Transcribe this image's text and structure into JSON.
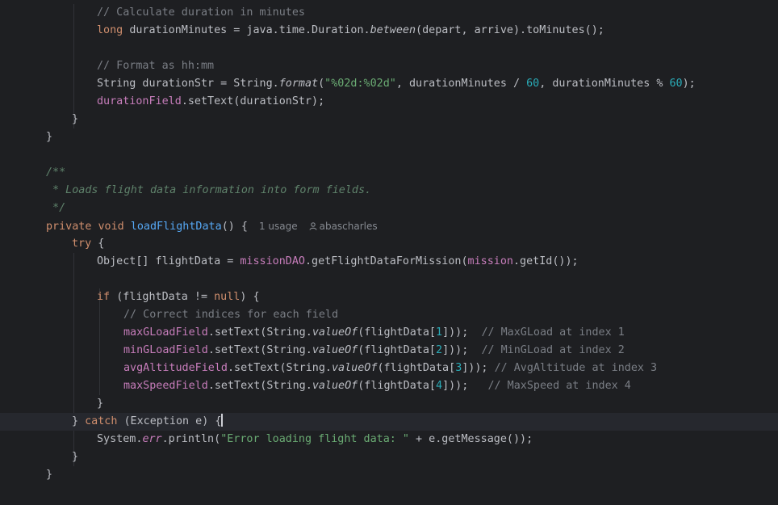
{
  "editor": {
    "current_line_index": 23,
    "caret_line_index": 23,
    "lines": [
      {
        "indent": 120,
        "tokens": [
          {
            "t": "// Calculate duration in minutes",
            "k": "comment"
          }
        ]
      },
      {
        "indent": 120,
        "tokens": [
          {
            "t": "long ",
            "k": "keyword"
          },
          {
            "t": "durationMinutes = java.time.Duration.",
            "k": "plain"
          },
          {
            "t": "between",
            "k": "static"
          },
          {
            "t": "(depart, arrive).toMinutes();",
            "k": "plain"
          }
        ]
      },
      {
        "indent": 0,
        "tokens": []
      },
      {
        "indent": 120,
        "tokens": [
          {
            "t": "// Format as hh:mm",
            "k": "comment"
          }
        ]
      },
      {
        "indent": 120,
        "tokens": [
          {
            "t": "String durationStr = String.",
            "k": "plain"
          },
          {
            "t": "format",
            "k": "static"
          },
          {
            "t": "(",
            "k": "plain"
          },
          {
            "t": "\"%02d:%02d\"",
            "k": "string"
          },
          {
            "t": ", durationMinutes / ",
            "k": "plain"
          },
          {
            "t": "60",
            "k": "number"
          },
          {
            "t": ", durationMinutes % ",
            "k": "plain"
          },
          {
            "t": "60",
            "k": "number"
          },
          {
            "t": ");",
            "k": "plain"
          }
        ]
      },
      {
        "indent": 120,
        "tokens": [
          {
            "t": "durationField",
            "k": "field"
          },
          {
            "t": ".setText(durationStr);",
            "k": "plain"
          }
        ]
      },
      {
        "indent": 89,
        "tokens": [
          {
            "t": "}",
            "k": "plain"
          }
        ]
      },
      {
        "indent": 57,
        "tokens": [
          {
            "t": "}",
            "k": "plain"
          }
        ]
      },
      {
        "indent": 0,
        "tokens": []
      },
      {
        "indent": 57,
        "tokens": [
          {
            "t": "/**",
            "k": "doc"
          }
        ]
      },
      {
        "indent": 57,
        "tokens": [
          {
            "t": " * Loads flight data information into form fields.",
            "k": "doc"
          }
        ]
      },
      {
        "indent": 57,
        "tokens": [
          {
            "t": " */",
            "k": "doc"
          }
        ]
      },
      {
        "indent": 57,
        "tokens": [
          {
            "t": "private void ",
            "k": "keyword"
          },
          {
            "t": "loadFlightData",
            "k": "method"
          },
          {
            "t": "() {",
            "k": "plain"
          }
        ],
        "inlay": {
          "usage": "1 usage",
          "author": "abascharles"
        }
      },
      {
        "indent": 89,
        "tokens": [
          {
            "t": "try ",
            "k": "keyword"
          },
          {
            "t": "{",
            "k": "plain"
          }
        ]
      },
      {
        "indent": 120,
        "tokens": [
          {
            "t": "Object[] flightData = ",
            "k": "plain"
          },
          {
            "t": "missionDAO",
            "k": "field"
          },
          {
            "t": ".getFlightDataForMission(",
            "k": "plain"
          },
          {
            "t": "mission",
            "k": "field"
          },
          {
            "t": ".getId());",
            "k": "plain"
          }
        ]
      },
      {
        "indent": 0,
        "tokens": []
      },
      {
        "indent": 120,
        "tokens": [
          {
            "t": "if ",
            "k": "keyword"
          },
          {
            "t": "(flightData != ",
            "k": "plain"
          },
          {
            "t": "null",
            "k": "keyword"
          },
          {
            "t": ") {",
            "k": "plain"
          }
        ]
      },
      {
        "indent": 153,
        "tokens": [
          {
            "t": "// Correct indices for each field",
            "k": "comment"
          }
        ]
      },
      {
        "indent": 153,
        "tokens": [
          {
            "t": "maxGLoadField",
            "k": "field"
          },
          {
            "t": ".setText(String.",
            "k": "plain"
          },
          {
            "t": "valueOf",
            "k": "static"
          },
          {
            "t": "(flightData[",
            "k": "plain"
          },
          {
            "t": "1",
            "k": "number"
          },
          {
            "t": "]));  ",
            "k": "plain"
          },
          {
            "t": "// MaxGLoad at index 1",
            "k": "comment"
          }
        ]
      },
      {
        "indent": 153,
        "tokens": [
          {
            "t": "minGLoadField",
            "k": "field"
          },
          {
            "t": ".setText(String.",
            "k": "plain"
          },
          {
            "t": "valueOf",
            "k": "static"
          },
          {
            "t": "(flightData[",
            "k": "plain"
          },
          {
            "t": "2",
            "k": "number"
          },
          {
            "t": "]));  ",
            "k": "plain"
          },
          {
            "t": "// MinGLoad at index 2",
            "k": "comment"
          }
        ]
      },
      {
        "indent": 153,
        "tokens": [
          {
            "t": "avgAltitudeField",
            "k": "field"
          },
          {
            "t": ".setText(String.",
            "k": "plain"
          },
          {
            "t": "valueOf",
            "k": "static"
          },
          {
            "t": "(flightData[",
            "k": "plain"
          },
          {
            "t": "3",
            "k": "number"
          },
          {
            "t": "])); ",
            "k": "plain"
          },
          {
            "t": "// AvgAltitude at index 3",
            "k": "comment"
          }
        ]
      },
      {
        "indent": 153,
        "tokens": [
          {
            "t": "maxSpeedField",
            "k": "field"
          },
          {
            "t": ".setText(String.",
            "k": "plain"
          },
          {
            "t": "valueOf",
            "k": "static"
          },
          {
            "t": "(flightData[",
            "k": "plain"
          },
          {
            "t": "4",
            "k": "number"
          },
          {
            "t": "]));   ",
            "k": "plain"
          },
          {
            "t": "// MaxSpeed at index 4",
            "k": "comment"
          }
        ]
      },
      {
        "indent": 120,
        "tokens": [
          {
            "t": "}",
            "k": "plain"
          }
        ]
      },
      {
        "indent": 89,
        "tokens": [
          {
            "t": "} ",
            "k": "plain"
          },
          {
            "t": "catch ",
            "k": "keyword"
          },
          {
            "t": "(Exception e) {",
            "k": "plain"
          }
        ]
      },
      {
        "indent": 120,
        "tokens": [
          {
            "t": "System.",
            "k": "plain"
          },
          {
            "t": "err",
            "k": "staticfield"
          },
          {
            "t": ".println(",
            "k": "plain"
          },
          {
            "t": "\"Error loading flight data: \"",
            "k": "string"
          },
          {
            "t": " + e.getMessage());",
            "k": "plain"
          }
        ]
      },
      {
        "indent": 89,
        "tokens": [
          {
            "t": "}",
            "k": "plain"
          }
        ]
      },
      {
        "indent": 57,
        "tokens": [
          {
            "t": "}",
            "k": "plain"
          }
        ]
      },
      {
        "indent": 0,
        "tokens": []
      }
    ]
  }
}
